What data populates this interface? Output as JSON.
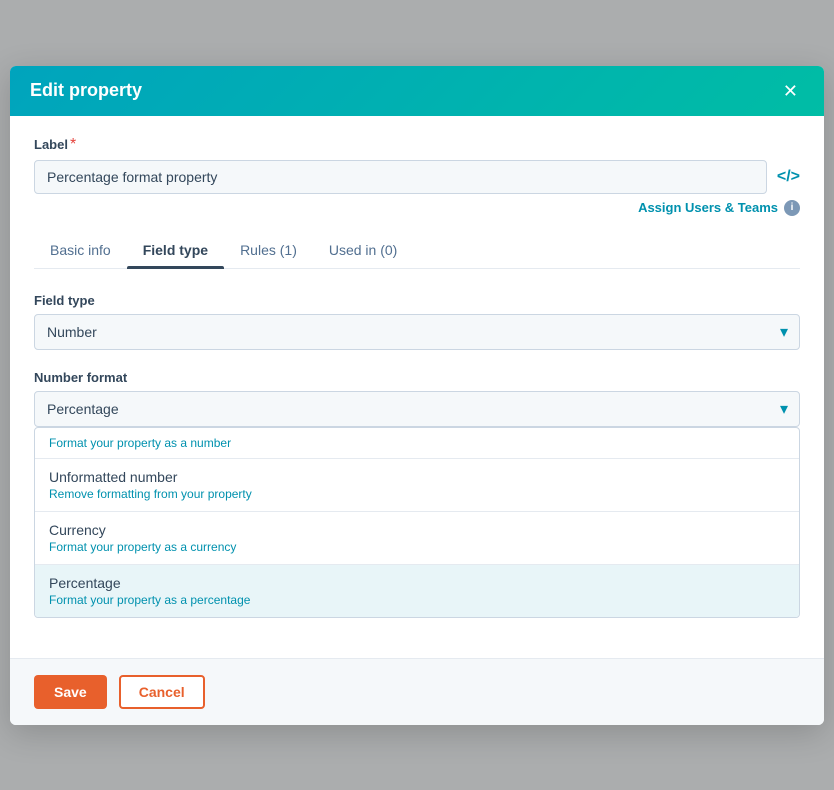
{
  "modal": {
    "title": "Edit property",
    "close_label": "✕"
  },
  "label_field": {
    "label": "Label",
    "required": "*",
    "value": "Percentage format property",
    "placeholder": "Enter label"
  },
  "code_icon": "</>",
  "assign_link": {
    "text": "Assign Users & Teams",
    "info_tooltip": "i"
  },
  "tabs": [
    {
      "id": "basic-info",
      "label": "Basic info",
      "active": false
    },
    {
      "id": "field-type",
      "label": "Field type",
      "active": true
    },
    {
      "id": "rules",
      "label": "Rules (1)",
      "active": false
    },
    {
      "id": "used-in",
      "label": "Used in (0)",
      "active": false
    }
  ],
  "field_type": {
    "label": "Field type",
    "value": "Number"
  },
  "number_format": {
    "label": "Number format",
    "value": "Percentage",
    "hint": "Format your property as a number",
    "options": [
      {
        "id": "unformatted",
        "title": "Unformatted number",
        "desc": "Remove formatting from your property",
        "selected": false
      },
      {
        "id": "currency",
        "title": "Currency",
        "desc": "Format your property as a currency",
        "selected": false
      },
      {
        "id": "percentage",
        "title": "Percentage",
        "desc": "Format your property as a percentage",
        "selected": true
      }
    ]
  },
  "footer": {
    "save_label": "Save",
    "cancel_label": "Cancel"
  }
}
